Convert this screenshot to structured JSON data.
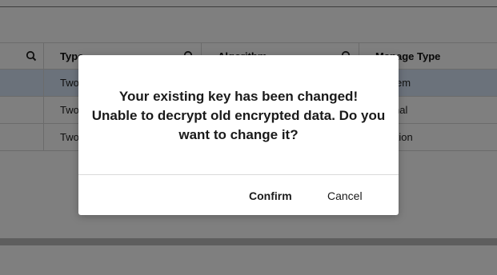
{
  "table": {
    "columns": [
      {
        "label": ""
      },
      {
        "label": "Type"
      },
      {
        "label": "Algorithm"
      },
      {
        "label": "Manage Type"
      }
    ],
    "rows": [
      {
        "type": "Two",
        "algorithm": "",
        "manage_type": "em",
        "selected": true
      },
      {
        "type": "Two",
        "algorithm": "",
        "manage_type": "nal",
        "selected": false
      },
      {
        "type": "Two",
        "algorithm": "",
        "manage_type": "cation",
        "selected": false
      }
    ]
  },
  "dialog": {
    "message_lines": [
      "Your existing key has been changed!",
      "Unable to decrypt old encrypted data. Do you",
      "want to change it?"
    ],
    "confirm_label": "Confirm",
    "cancel_label": "Cancel"
  },
  "colors": {
    "overlay": "rgba(0,0,0,0.5)",
    "selected_row": "#d7e5f7",
    "dialog_bg": "#ffffff"
  },
  "icons": {
    "column_filter": "search-icon"
  }
}
